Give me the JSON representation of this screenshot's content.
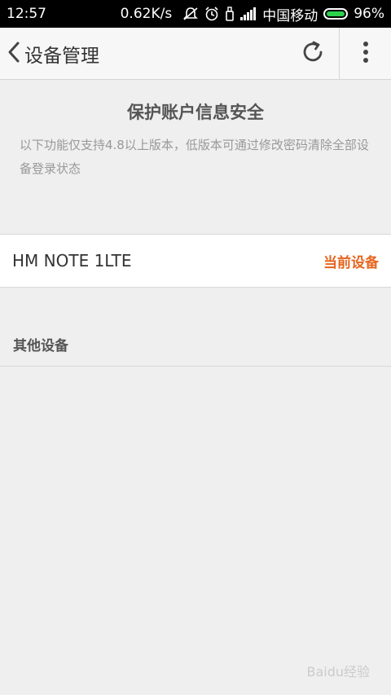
{
  "status_bar": {
    "time": "12:57",
    "speed": "0.62K/s",
    "carrier": "中国移动",
    "battery": "96%",
    "battery_level": 0.96,
    "icons": [
      "mute-icon",
      "alarm-icon",
      "usb-icon",
      "signal-icon",
      "battery-icon"
    ]
  },
  "header": {
    "title": "设备管理",
    "back_icon": "chevron-left-icon",
    "refresh_icon": "refresh-icon",
    "more_icon": "more-vertical-icon"
  },
  "intro": {
    "title": "保护账户信息安全",
    "description": "以下功能仅支持4.8以上版本，低版本可通过修改密码清除全部设备登录状态"
  },
  "current_device": {
    "name": "HM NOTE 1LTE",
    "tag": "当前设备"
  },
  "other_devices": {
    "title": "其他设备"
  },
  "watermark": "Baidu经验",
  "colors": {
    "accent": "#e5651e",
    "background": "#efefef",
    "header_bg": "#f7f7f7"
  }
}
